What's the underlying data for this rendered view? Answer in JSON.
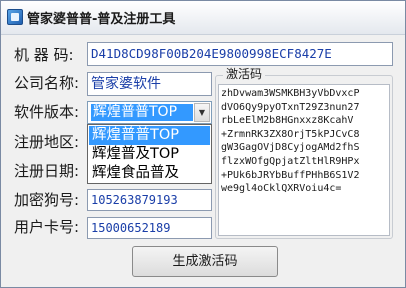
{
  "window": {
    "title": "管家婆普普-普及注册工具"
  },
  "form": {
    "machine_code_label": "机 器 码:",
    "machine_code_value": "D41D8CD98F00B204E9800998ECF8427E",
    "company_label": "公司名称:",
    "company_value": "管家婆软件",
    "version_label": "软件版本:",
    "version_selected": "辉煌普普TOP",
    "version_options": [
      "辉煌普普TOP",
      "辉煌普及TOP",
      "辉煌食品普及"
    ],
    "region_label": "注册地区:",
    "date_label": "注册日期:",
    "dongle_label": "加密狗号:",
    "dongle_value": "105263879193",
    "card_label": "用户卡号:",
    "card_value": "15000652189"
  },
  "activation": {
    "group_label": "激活码",
    "code_lines": [
      "zhDvwam3WSMKBH3yVbDvxcP",
      "dVO6Qy9pyOTxnT29Z3nun27",
      "rbLeElM2b8HGnxxz8KcahV",
      "+ZrmnRK3ZX8OrjT5kPJCvC8",
      "gW3GagOVjD8CyjogAMd2fhS",
      "flzxWOfgQpjatZltHlR9HPx",
      "+PUk6bJRYbBuffPHhB6S1V2",
      "we9gl4oCklQXRVoiu4c="
    ]
  },
  "buttons": {
    "generate_label": "生成激活码"
  }
}
